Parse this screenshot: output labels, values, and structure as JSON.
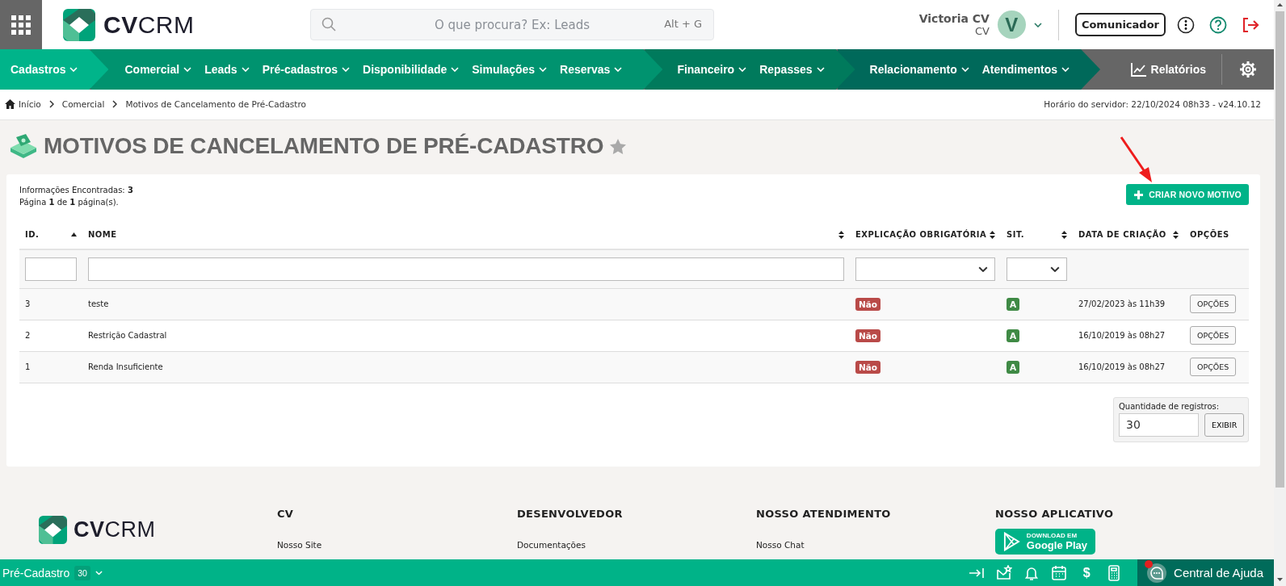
{
  "header": {
    "logo": "**CV**CRM",
    "search_placeholder": "O que procura? Ex: Leads",
    "search_shortcut": "Alt + G",
    "user_name": "Victoria CV",
    "user_role": "CV",
    "avatar_letter": "V",
    "communicator_button": "Comunicador"
  },
  "nav": {
    "groups": [
      {
        "color": "#00b48a",
        "items": [
          "Cadastros"
        ]
      },
      {
        "color": "#00936f",
        "items": [
          "Comercial",
          "Leads",
          "Pré-cadastros",
          "Disponibilidade",
          "Simulações",
          "Reservas"
        ]
      },
      {
        "color": "#007a5c",
        "items": [
          "Financeiro",
          "Repasses"
        ]
      },
      {
        "color": "#00695a",
        "items": [
          "Relacionamento",
          "Atendimentos"
        ]
      }
    ],
    "reports": "Relatórios"
  },
  "breadcrumb": {
    "items": [
      "Início",
      "Comercial",
      "Motivos de Cancelamento de Pré-Cadastro"
    ],
    "server_time": "Horário do servidor: 22/10/2024 08h33 - v24.10.12"
  },
  "page": {
    "title": "MOTIVOS DE CANCELAMENTO DE PRÉ-CADASTRO",
    "favorite": false
  },
  "summary": {
    "found": "Informações Encontradas: **3**",
    "pages": "Página **1** de **1** página(s)."
  },
  "create_button": "CRIAR NOVO MOTIVO",
  "table": {
    "columns": [
      {
        "label": "ID.",
        "sortable": true,
        "sorted": true,
        "kind": "text"
      },
      {
        "label": "NOME",
        "sortable": true,
        "sorted": false,
        "kind": "text"
      },
      {
        "label": "EXPLICAÇÃO OBRIGATÓRIA",
        "sortable": true,
        "sorted": false,
        "kind": "select"
      },
      {
        "label": "SIT.",
        "sortable": true,
        "sorted": false,
        "kind": "select"
      },
      {
        "label": "DATA DE CRIAÇÃO",
        "sortable": true,
        "sorted": false,
        "kind": "plain"
      },
      {
        "label": "OPÇÕES",
        "sortable": false,
        "kind": "plain"
      }
    ],
    "rows": [
      {
        "id": "3",
        "name": "teste",
        "required": "Não",
        "status": "A",
        "created": "27/02/2023 às 11h39",
        "options": "OPÇÕES"
      },
      {
        "id": "2",
        "name": "Restrição Cadastral",
        "required": "Não",
        "status": "A",
        "created": "16/10/2019 às 08h27",
        "options": "OPÇÕES"
      },
      {
        "id": "1",
        "name": "Renda Insuficiente",
        "required": "Não",
        "status": "A",
        "created": "16/10/2019 às 08h27",
        "options": "OPÇÕES"
      }
    ]
  },
  "page_size": {
    "label": "Quantidade de registros:",
    "value": "30",
    "button": "EXIBIR"
  },
  "footer": {
    "logo": "**CV**CRM",
    "columns": [
      {
        "heading": "CV",
        "links": [
          "Nosso Site"
        ]
      },
      {
        "heading": "DESENVOLVEDOR",
        "links": [
          "Documentações"
        ]
      },
      {
        "heading": "NOSSO ATENDIMENTO",
        "links": [
          "Nosso Chat"
        ]
      }
    ],
    "app": {
      "heading": "NOSSO APLICATIVO",
      "badge_small": "DOWNLOAD EM",
      "badge_big": "Google Play"
    }
  },
  "bottom_bar": {
    "module": "Pré-Cadastro",
    "count": "30",
    "finance_glyph": "$",
    "help": "Central de Ajuda",
    "help_notification": true
  }
}
